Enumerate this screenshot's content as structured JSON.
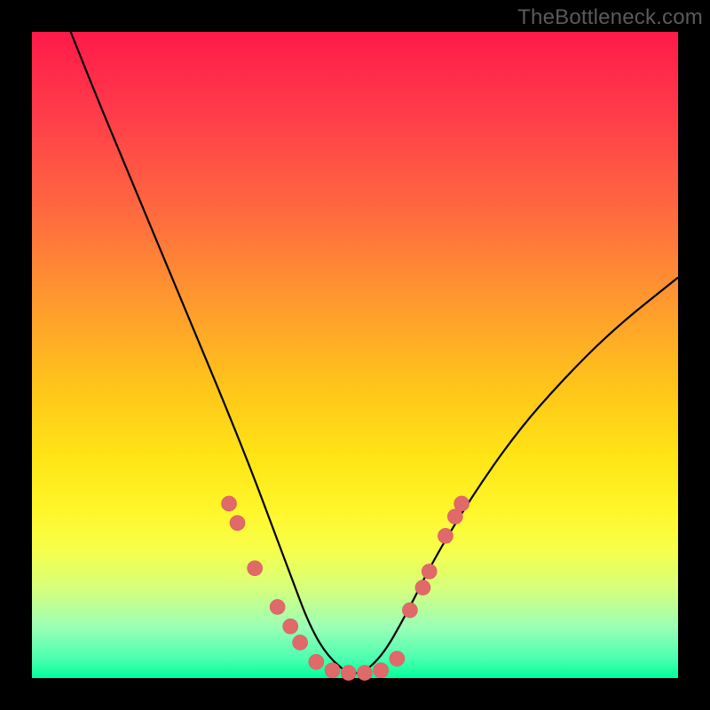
{
  "watermark": "TheBottleneck.com",
  "colors": {
    "frame": "#000000",
    "dot": "#e06a6a",
    "curve": "#000000",
    "gradient_stops": [
      "#ff1a49",
      "#ff3a4a",
      "#ff6a3f",
      "#ff9a2e",
      "#ffc51a",
      "#ffe516",
      "#fff62a",
      "#f7ff4a",
      "#d7ff7a",
      "#9bffb6",
      "#4cffb0",
      "#00ff99"
    ]
  },
  "chart_data": {
    "type": "line",
    "title": "",
    "xlabel": "",
    "ylabel": "",
    "xlim": [
      0,
      100
    ],
    "ylim": [
      0,
      100
    ],
    "grid": false,
    "legend": false,
    "series": [
      {
        "name": "bottleneck-curve",
        "x": [
          6,
          10,
          15,
          20,
          25,
          30,
          34,
          37,
          40,
          43,
          46,
          50,
          54,
          58,
          62,
          68,
          75,
          82,
          90,
          100
        ],
        "y": [
          100,
          90,
          78,
          66,
          54,
          42,
          32,
          24,
          16,
          8,
          3,
          0,
          3,
          10,
          18,
          28,
          38,
          46,
          54,
          62
        ]
      }
    ],
    "markers": [
      {
        "x": 30.5,
        "y": 27
      },
      {
        "x": 31.8,
        "y": 24
      },
      {
        "x": 34.5,
        "y": 17
      },
      {
        "x": 38.0,
        "y": 11
      },
      {
        "x": 40.0,
        "y": 8
      },
      {
        "x": 41.5,
        "y": 5.5
      },
      {
        "x": 44.0,
        "y": 2.5
      },
      {
        "x": 46.5,
        "y": 1.2
      },
      {
        "x": 49.0,
        "y": 0.8
      },
      {
        "x": 51.5,
        "y": 0.8
      },
      {
        "x": 54.0,
        "y": 1.2
      },
      {
        "x": 56.5,
        "y": 3.0
      },
      {
        "x": 58.5,
        "y": 10.5
      },
      {
        "x": 60.5,
        "y": 14
      },
      {
        "x": 61.5,
        "y": 16.5
      },
      {
        "x": 64.0,
        "y": 22
      },
      {
        "x": 65.5,
        "y": 25
      },
      {
        "x": 66.5,
        "y": 27
      }
    ]
  }
}
